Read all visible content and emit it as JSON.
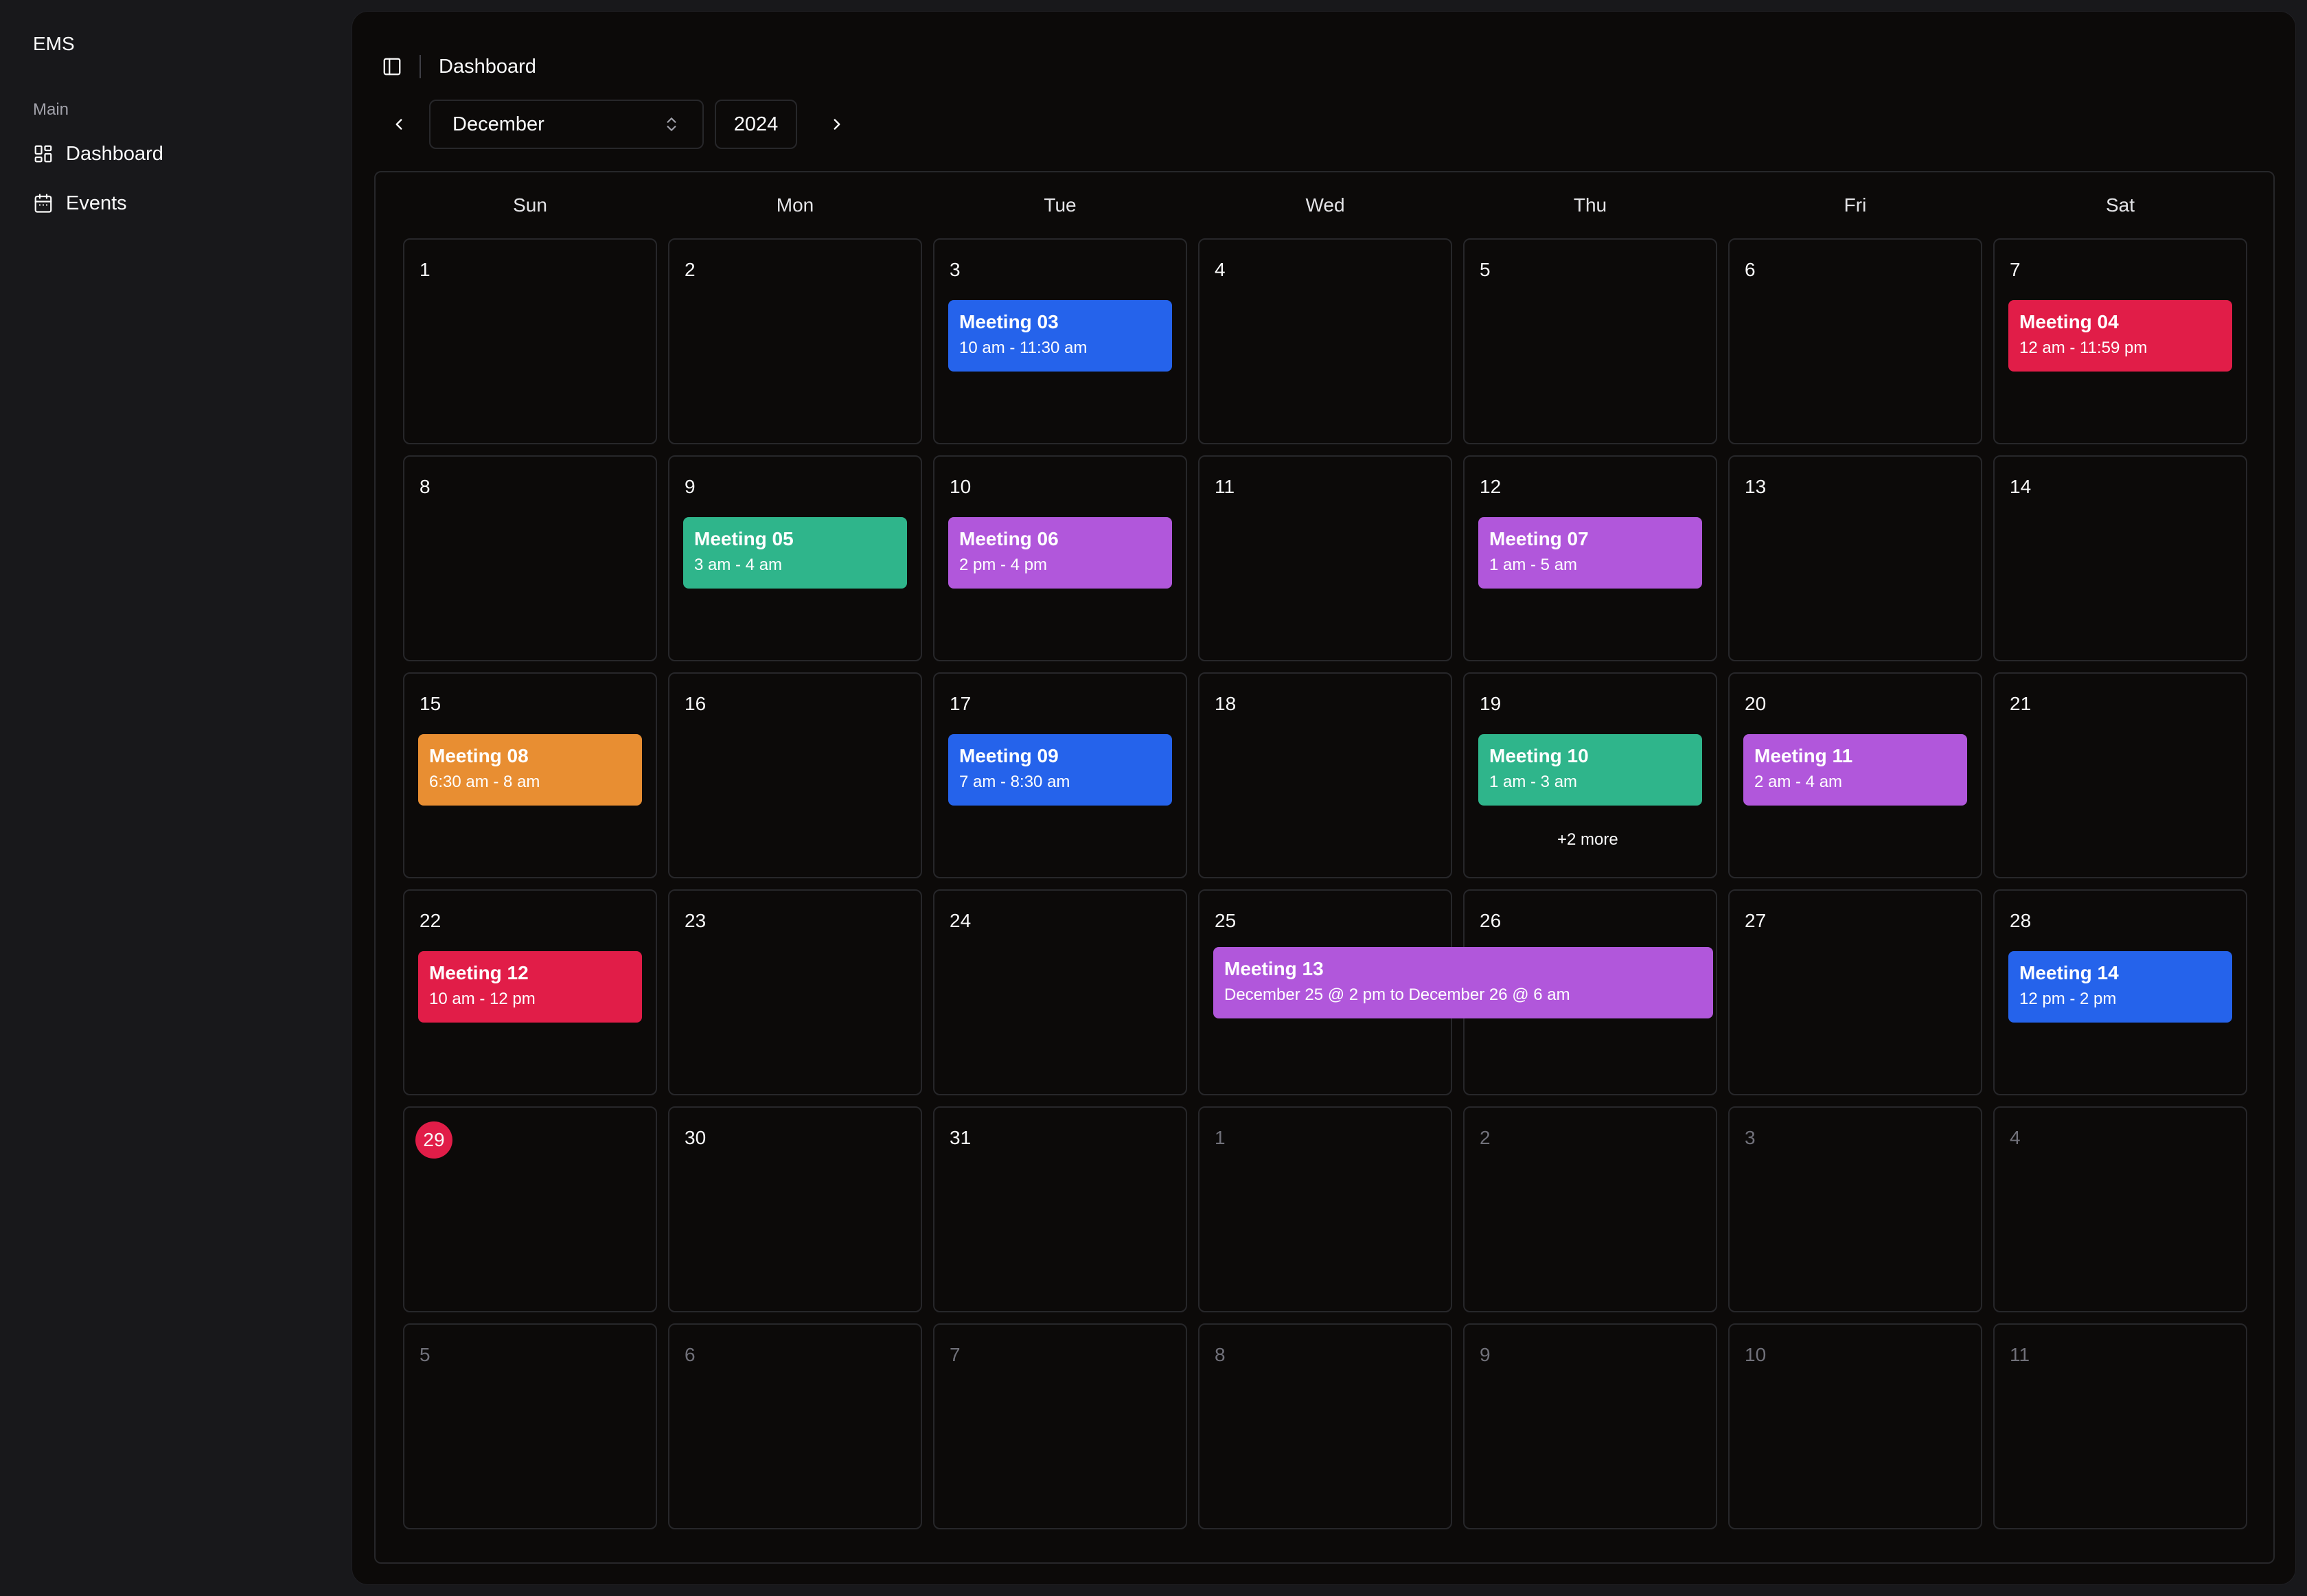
{
  "app": {
    "brand": "EMS"
  },
  "sidebar": {
    "group_label": "Main",
    "items": [
      {
        "label": "Dashboard",
        "icon": "layout-dashboard-icon"
      },
      {
        "label": "Events",
        "icon": "calendar-icon"
      }
    ]
  },
  "header": {
    "breadcrumb": "Dashboard"
  },
  "calendar_nav": {
    "month": "December",
    "year": "2024"
  },
  "calendar": {
    "weekdays": [
      "Sun",
      "Mon",
      "Tue",
      "Wed",
      "Thu",
      "Fri",
      "Sat"
    ],
    "weeks": [
      [
        {
          "d": "1",
          "in": true
        },
        {
          "d": "2",
          "in": true
        },
        {
          "d": "3",
          "in": true
        },
        {
          "d": "4",
          "in": true
        },
        {
          "d": "5",
          "in": true
        },
        {
          "d": "6",
          "in": true
        },
        {
          "d": "7",
          "in": true
        }
      ],
      [
        {
          "d": "8",
          "in": true
        },
        {
          "d": "9",
          "in": true
        },
        {
          "d": "10",
          "in": true
        },
        {
          "d": "11",
          "in": true
        },
        {
          "d": "12",
          "in": true
        },
        {
          "d": "13",
          "in": true
        },
        {
          "d": "14",
          "in": true
        }
      ],
      [
        {
          "d": "15",
          "in": true
        },
        {
          "d": "16",
          "in": true
        },
        {
          "d": "17",
          "in": true
        },
        {
          "d": "18",
          "in": true
        },
        {
          "d": "19",
          "in": true
        },
        {
          "d": "20",
          "in": true
        },
        {
          "d": "21",
          "in": true
        }
      ],
      [
        {
          "d": "22",
          "in": true
        },
        {
          "d": "23",
          "in": true
        },
        {
          "d": "24",
          "in": true
        },
        {
          "d": "25",
          "in": true
        },
        {
          "d": "26",
          "in": true
        },
        {
          "d": "27",
          "in": true
        },
        {
          "d": "28",
          "in": true
        }
      ],
      [
        {
          "d": "29",
          "in": true,
          "today": true
        },
        {
          "d": "30",
          "in": true
        },
        {
          "d": "31",
          "in": true
        },
        {
          "d": "1",
          "in": false
        },
        {
          "d": "2",
          "in": false
        },
        {
          "d": "3",
          "in": false
        },
        {
          "d": "4",
          "in": false
        }
      ],
      [
        {
          "d": "5",
          "in": false
        },
        {
          "d": "6",
          "in": false
        },
        {
          "d": "7",
          "in": false
        },
        {
          "d": "8",
          "in": false
        },
        {
          "d": "9",
          "in": false
        },
        {
          "d": "10",
          "in": false
        },
        {
          "d": "11",
          "in": false
        }
      ]
    ],
    "events": [
      {
        "title": "Meeting 03",
        "time": "10 am - 11:30 am",
        "week": 0,
        "day": 2,
        "span": 1,
        "color": "#2563eb"
      },
      {
        "title": "Meeting 04",
        "time": "12 am - 11:59 pm",
        "week": 0,
        "day": 6,
        "span": 1,
        "color": "#e11d48"
      },
      {
        "title": "Meeting 05",
        "time": "3 am - 4 am",
        "week": 1,
        "day": 1,
        "span": 1,
        "color": "#2fb58b"
      },
      {
        "title": "Meeting 06",
        "time": "2 pm - 4 pm",
        "week": 1,
        "day": 2,
        "span": 1,
        "color": "#b157db"
      },
      {
        "title": "Meeting 07",
        "time": "1 am - 5 am",
        "week": 1,
        "day": 4,
        "span": 1,
        "color": "#b157db"
      },
      {
        "title": "Meeting 08",
        "time": "6:30 am - 8 am",
        "week": 2,
        "day": 0,
        "span": 1,
        "color": "#e88e32"
      },
      {
        "title": "Meeting 09",
        "time": "7 am - 8:30 am",
        "week": 2,
        "day": 2,
        "span": 1,
        "color": "#2563eb"
      },
      {
        "title": "Meeting 10",
        "time": "1 am - 3 am",
        "week": 2,
        "day": 4,
        "span": 1,
        "color": "#2fb58b"
      },
      {
        "title": "Meeting 11",
        "time": "2 am - 4 am",
        "week": 2,
        "day": 5,
        "span": 1,
        "color": "#b157db"
      },
      {
        "title": "Meeting 12",
        "time": "10 am - 12 pm",
        "week": 3,
        "day": 0,
        "span": 1,
        "color": "#e11d48"
      },
      {
        "title": "Meeting 13",
        "time": "December 25 @ 2 pm to December 26 @ 6 am",
        "week": 3,
        "day": 3,
        "span": 2,
        "color": "#b157db"
      },
      {
        "title": "Meeting 14",
        "time": "12 pm - 2 pm",
        "week": 3,
        "day": 6,
        "span": 1,
        "color": "#2563eb"
      }
    ],
    "more_links": [
      {
        "label": "+2 more",
        "week": 2,
        "day": 4
      }
    ]
  }
}
